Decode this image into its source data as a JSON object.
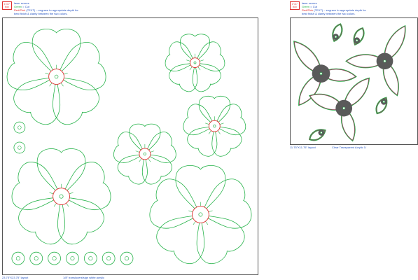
{
  "left_legend": {
    "size_label": "1\"x1\"",
    "size_sub": "box",
    "line1": "laser scores",
    "line2_color": "Green",
    "line2_text": "= Cut",
    "line3_color": "Red/Pink",
    "line3_text": "(TEXT) – engrave to appropriate depth for",
    "line4": "best finish & clarity between the two colors."
  },
  "right_legend": {
    "size_label": "1\"x1\"",
    "size_sub": "box",
    "line1": "laser scores",
    "line2_color": "Green",
    "line2_text": "= Cut",
    "line3_color": "Red/Pink",
    "line3_text": "(TEXT) – engrave to appropriate depth for",
    "line4": "best finish & clarity between the two colors."
  },
  "left_panel": {
    "caption_size": "23.75\"X23.75\" layout",
    "caption_material": "1/8\" translucent/sign white acrylic"
  },
  "right_panel": {
    "caption_size": "11.75\"X11.75\" layout",
    "caption_material": "Clear Transparent Acrylic  1/"
  },
  "colors": {
    "cut": "#27b34a",
    "engrave": "#e03030",
    "fill": "#5a5a5a",
    "text": "#2050c0",
    "border": "#555555"
  }
}
